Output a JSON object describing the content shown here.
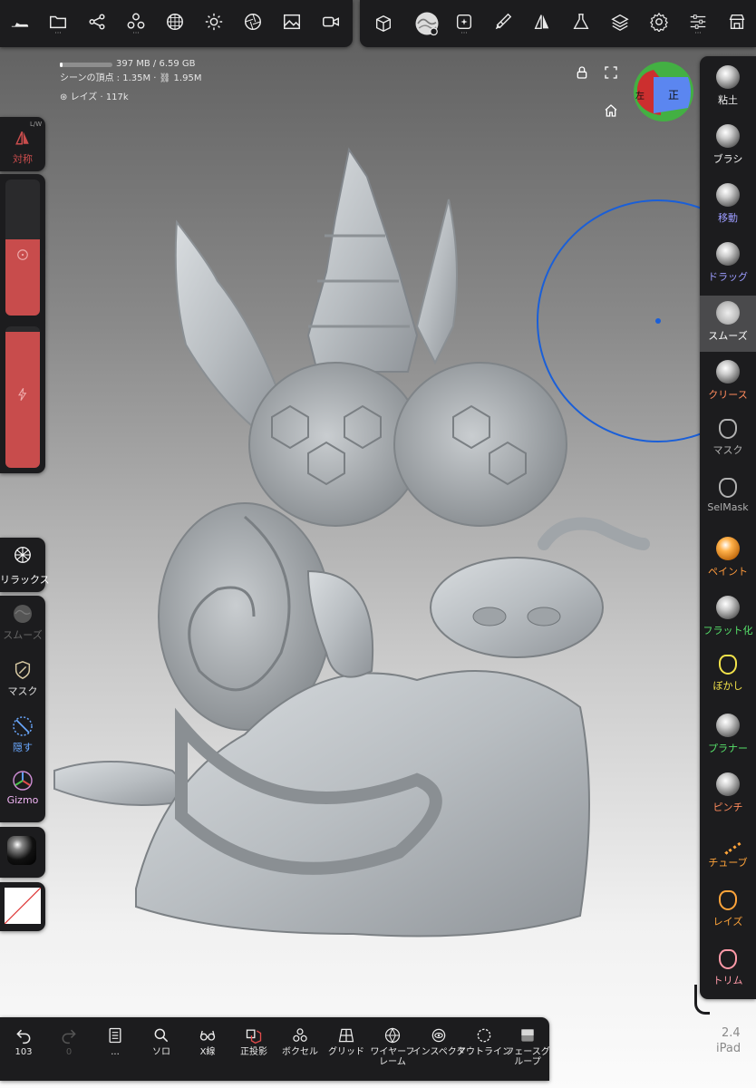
{
  "stats": {
    "memory": "397 MB / 6.59 GB",
    "scene": "シーンの頂点 : 1.35M · ",
    "scene_links": "1.95M",
    "layer": "レイズ · 117k"
  },
  "symmetry": {
    "label": "対称",
    "mode": "L/W"
  },
  "cube": {
    "left_face": "左",
    "front_face": "正"
  },
  "right_tools": [
    {
      "label": "粘土",
      "color": "#f2f2f2"
    },
    {
      "label": "ブラシ",
      "color": "#f2f2f2"
    },
    {
      "label": "移動",
      "color": "#9c9cff"
    },
    {
      "label": "ドラッグ",
      "color": "#9c9cff"
    },
    {
      "label": "スムーズ",
      "color": "#ffffff"
    },
    {
      "label": "クリース",
      "color": "#ff8a5c"
    },
    {
      "label": "マスク",
      "color": "#b0b0b0"
    },
    {
      "label": "SelMask",
      "color": "#b0b0b0"
    },
    {
      "label": "ペイント",
      "color": "#ff9a3c"
    },
    {
      "label": "フラット化",
      "color": "#56e06a"
    },
    {
      "label": "ぼかし",
      "color": "#f2e24a"
    },
    {
      "label": "プラナー",
      "color": "#56e06a"
    },
    {
      "label": "ピンチ",
      "color": "#ff8a5c"
    },
    {
      "label": "チューブ",
      "color": "#ffa43a"
    },
    {
      "label": "レイズ",
      "color": "#ffa43a"
    },
    {
      "label": "トリム",
      "color": "#ff9aa8"
    }
  ],
  "left_tools": {
    "relax": "リラックス",
    "smooth": "スムーズ",
    "mask": "マスク",
    "hide": "隠す",
    "gizmo": "Gizmo"
  },
  "bottom_bar": {
    "undo": "103",
    "redo": "0",
    "more": "...",
    "solo": "ソロ",
    "xray": "X線",
    "ortho": "正投影",
    "voxel": "ボクセル",
    "grid": "グリッド",
    "wireframe": "ワイヤーフレーム",
    "inspect": "インスペクタ",
    "outline": "アウトライン",
    "facegroup": "フェースグループ"
  },
  "version": {
    "number": "2.4",
    "device": "iPad"
  },
  "colors": {
    "accent_red": "#c84c4c",
    "brush_circle": "#1a5fd8",
    "panel": "#1c1c1e"
  }
}
